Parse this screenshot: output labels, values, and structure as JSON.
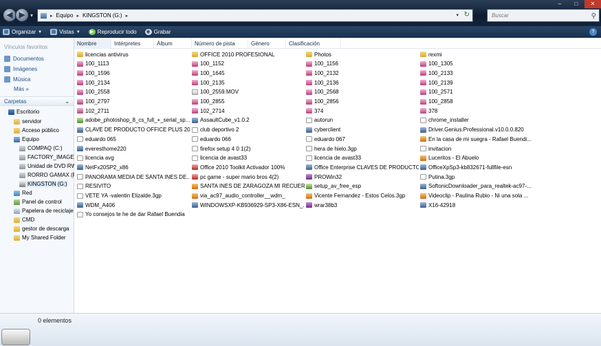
{
  "address": {
    "segments": [
      "Equipo",
      "KINGSTON (G:)"
    ],
    "search_placeholder": "Buscar"
  },
  "toolbar": {
    "organize": "Organizar",
    "views": "Vistas",
    "play_all": "Reproducir todo",
    "burn": "Grabar"
  },
  "sidebar": {
    "favorites_title": "Vínculos favoritos",
    "favorites": [
      "Documentos",
      "Imágenes",
      "Música"
    ],
    "more": "Más",
    "folders_title": "Carpetas",
    "tree": [
      {
        "label": "Escritorio",
        "icon": "desktop-icon"
      },
      {
        "label": "servidor",
        "icon": "folder-icon"
      },
      {
        "label": "Acceso público",
        "icon": "folder-icon"
      },
      {
        "label": "Equipo",
        "icon": "computer-icon"
      },
      {
        "label": "COMPAQ (C:)",
        "icon": "drive-icon"
      },
      {
        "label": "FACTORY_IMAGE",
        "icon": "drive-icon"
      },
      {
        "label": "Unidad de DVD RW",
        "icon": "dvd-drive-icon"
      },
      {
        "label": "RORRO GAMAX (F",
        "icon": "drive-icon"
      },
      {
        "label": "KINGSTON (G:)",
        "icon": "usb-drive-icon"
      },
      {
        "label": "Red",
        "icon": "network-icon"
      },
      {
        "label": "Panel de control",
        "icon": "control-panel-icon"
      },
      {
        "label": "Papelera de reciclaje",
        "icon": "recycle-bin-icon"
      },
      {
        "label": "CMD",
        "icon": "folder-icon"
      },
      {
        "label": "gestor de descarga",
        "icon": "folder-icon"
      },
      {
        "label": "My Shared Folder",
        "icon": "folder-icon"
      }
    ]
  },
  "columns": [
    "Nombre",
    "Intérpretes",
    "Álbum",
    "Número de pista",
    "Género",
    "Clasificación"
  ],
  "files": [
    [
      "licencias antivirus",
      "OFFICE 2010 PROFESIONAL",
      "Photos",
      "rexmi"
    ],
    [
      "100_1113",
      "100_1152",
      "100_1156",
      "100_1305"
    ],
    [
      "100_1596",
      "100_1645",
      "100_2132",
      "100_2133"
    ],
    [
      "100_2134",
      "100_2135",
      "100_2136",
      "100_2139"
    ],
    [
      "100_2558",
      "100_2559.MOV",
      "100_2568",
      "100_2571"
    ],
    [
      "100_2797",
      "100_2855",
      "100_2856",
      "100_2858"
    ],
    [
      "102_2711",
      "102_2714",
      "374",
      "378"
    ],
    [
      "adobe_photoshop_8_cs_full_+_serial_sp...",
      "AssaultCube_v1.0.2",
      "autorun",
      "chrome_installer"
    ],
    [
      "CLAVE DE PRODUCTO OFFICE PLUS 2010",
      "club deportivo 2",
      "cyberclient",
      "Driver.Genius.Professional.v10.0.0.820"
    ],
    [
      "eduardo 065",
      "eduardo 066",
      "eduardo 067",
      "En la casa de mi suegra - Rafael Buendi..."
    ],
    [
      "everesthome220",
      "firefox setup 4 0 1(2)",
      "hera de hielo.3gp",
      "invitacion"
    ],
    [
      "licencia avg",
      "licencia de avast33",
      "licencia de avast33",
      "Luceritos - El Abuelo"
    ],
    [
      "NetFx20SP2_x86",
      "Office 2010 Toolkit Activador 100%",
      "Office Enterprise CLAVES DE PRODUCTO",
      "OfficeXpSp3-kb832671-fullfile-esn"
    ],
    [
      "PANORAMA MEDIA DE SANTA INES DE...",
      "pc game - super mario bros 4(2)",
      "PROWin32",
      "Putina.3gp"
    ],
    [
      "RESIVITO",
      "SANTA INES DE ZARAGOZA MI RECUER...",
      "setup_av_free_esp",
      "SoftonicDownloader_para_realtek-ac97-..."
    ],
    [
      "VETE YA -valentin Elizalde.3gp",
      "via_ac97_audio_controller__wdm_",
      "Vicente Fernandez - Estos Celos.3gp",
      "Videoclip - Paulina Rubio - Ni una sola ..."
    ],
    [
      "WDM_A406",
      "WINDOWSXP-KB936929-SP3-X86-ESN_...",
      "wrar38b3",
      "X16-42918"
    ],
    [
      "Yo consejos te he de dar Rafael Buendia",
      "",
      "",
      ""
    ]
  ],
  "file_icons": [
    [
      "folder",
      "folder",
      "folder",
      "folder"
    ],
    [
      "img",
      "img",
      "img",
      "img"
    ],
    [
      "img",
      "img",
      "img",
      "img"
    ],
    [
      "img",
      "img",
      "img",
      "img"
    ],
    [
      "img",
      "video",
      "img",
      "img"
    ],
    [
      "img",
      "img",
      "img",
      "img"
    ],
    [
      "img",
      "img",
      "img",
      "img"
    ],
    [
      "setup",
      "exe",
      "doc",
      "doc"
    ],
    [
      "exe",
      "doc",
      "exe",
      "exe"
    ],
    [
      "doc",
      "doc",
      "doc",
      "media"
    ],
    [
      "exe",
      "doc",
      "doc",
      "doc"
    ],
    [
      "doc",
      "doc",
      "doc",
      "media"
    ],
    [
      "exe",
      "pdf",
      "exe",
      "exe"
    ],
    [
      "doc",
      "pdf",
      "rar",
      "doc"
    ],
    [
      "doc",
      "media",
      "setup",
      "exe"
    ],
    [
      "doc",
      "media",
      "media",
      "media"
    ],
    [
      "exe",
      "exe",
      "rar",
      "exe"
    ],
    [
      "doc",
      "",
      "",
      ""
    ]
  ],
  "status": {
    "count": "0 elementos"
  }
}
